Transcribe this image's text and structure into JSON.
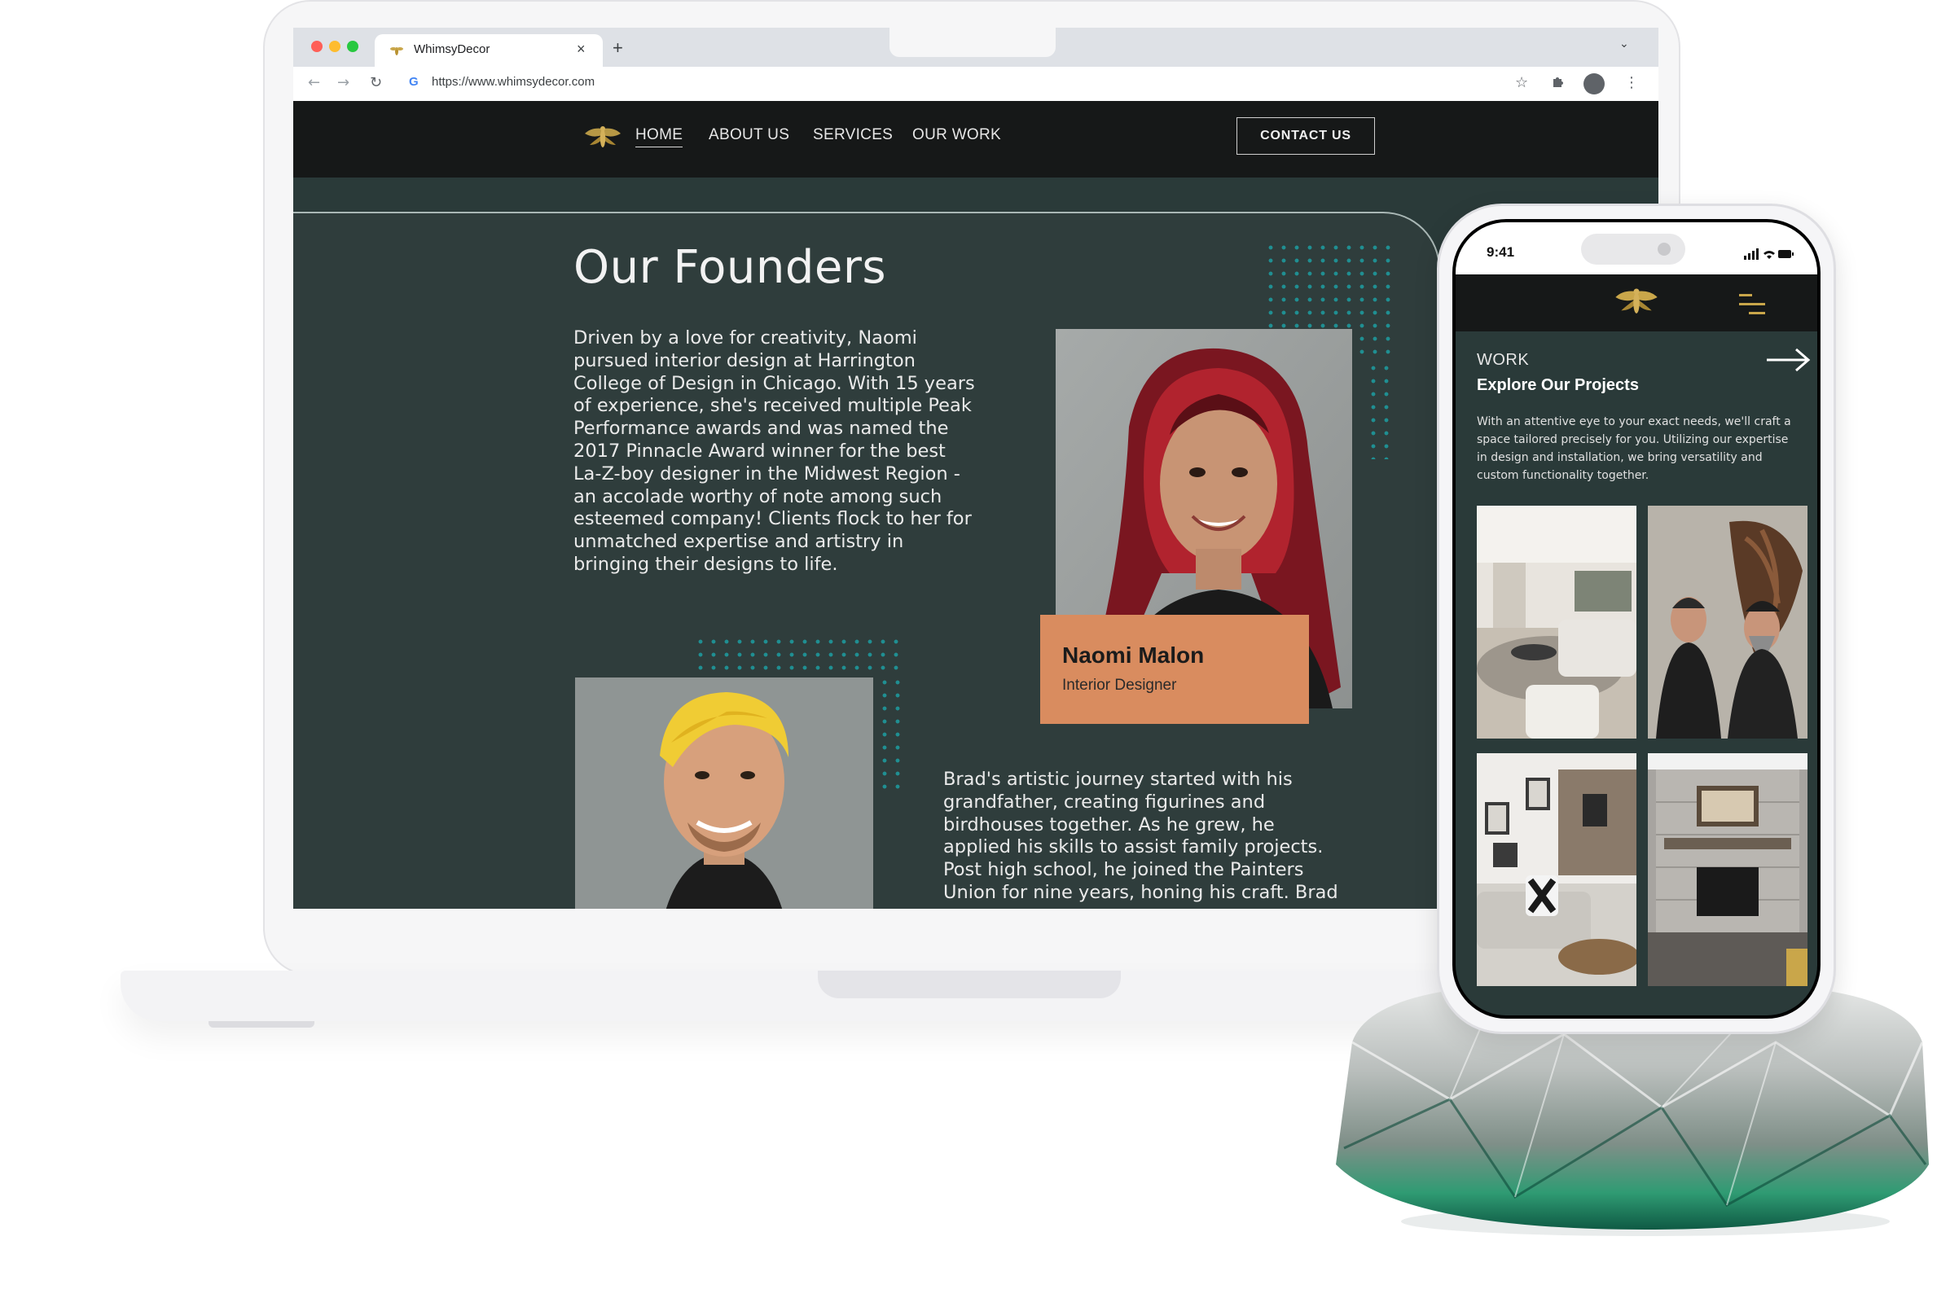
{
  "browser": {
    "tab_title": "WhimsyDecor",
    "tab_close": "×",
    "new_tab": "+",
    "url": "https://www.whimsydecor.com",
    "icons": [
      "back-arrow-icon",
      "forward-arrow-icon",
      "reload-icon",
      "google-g-icon",
      "bookmark-star-icon",
      "extensions-puzzle-icon",
      "profile-avatar-icon",
      "kebab-menu-icon"
    ]
  },
  "site": {
    "nav": {
      "items": [
        "HOME",
        "ABOUT US",
        "SERVICES",
        "OUR WORK"
      ],
      "active": "HOME",
      "contact_label": "CONTACT US"
    },
    "founders": {
      "heading": "Our Founders",
      "naomi_bio": [
        "Driven by a love for creativity, Naomi",
        "pursued interior design at Harrington",
        "College of Design in Chicago. With 15 years",
        "of experience, she's received multiple Peak",
        "Performance awards and was named the",
        "2017 Pinnacle Award winner for the best",
        "La-Z-boy designer in the Midwest Region -",
        "an accolade worthy of note among such",
        "esteemed company! Clients flock to her for",
        "unmatched expertise and artistry in",
        "bringing their designs to life."
      ],
      "naomi_name": "Naomi Malon",
      "naomi_role": "Interior Designer",
      "brad_bio": [
        "Brad's artistic journey started with his",
        "grandfather, creating figurines and",
        "birdhouses together. As he grew, he",
        "applied his skills to assist family projects.",
        "Post high school, he joined the Painters",
        "Union for nine years, honing his craft. Brad"
      ]
    },
    "colors": {
      "background": "#2a3a39",
      "nav": "#161818",
      "accent_orange": "#d98c5f",
      "dot_teal": "#1f8f92",
      "bee_gold": "#b8912f"
    }
  },
  "phone": {
    "time": "9:41",
    "section_label": "WORK",
    "section_title": "Explore Our Projects",
    "description": [
      "With an attentive eye to your exact needs, we'll craft a",
      "space tailored precisely for you. Utilizing our expertise",
      "in design and installation, we bring versatility and",
      "custom functionality together."
    ],
    "icons": [
      "bee-logo-icon",
      "hamburger-menu-icon",
      "right-arrow-icon",
      "signal-icon",
      "wifi-icon",
      "battery-icon"
    ]
  }
}
